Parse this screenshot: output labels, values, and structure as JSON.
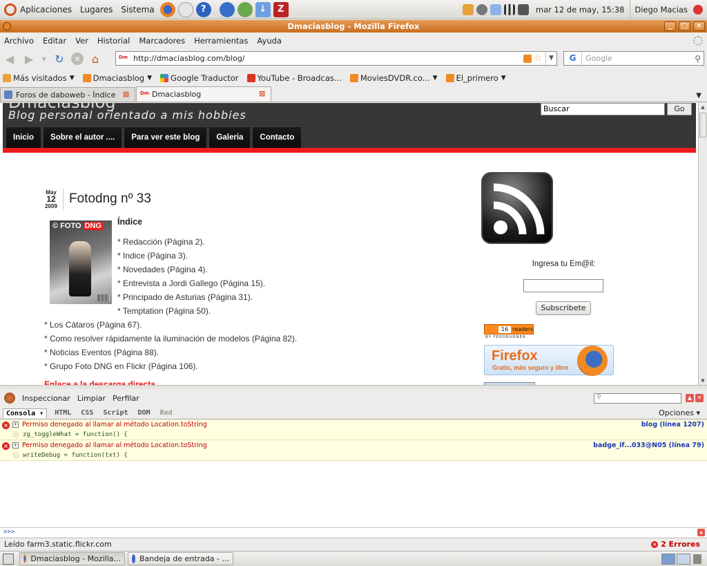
{
  "top_panel": {
    "menus": [
      "Aplicaciones",
      "Lugares",
      "Sistema"
    ],
    "clock": "mar 12 de may, 15:38",
    "user": "Diego Macias"
  },
  "window": {
    "title": "Dmaciasblog - Mozilla Firefox",
    "menu": [
      "Archivo",
      "Editar",
      "Ver",
      "Historial",
      "Marcadores",
      "Herramientas",
      "Ayuda"
    ]
  },
  "nav": {
    "url": "http://dmaciasblog.com/blog/",
    "url_favicon": "Dm",
    "search_placeholder": "Google",
    "search_engine_glyph": "G"
  },
  "bookmarks": [
    "Más visitados",
    "Dmaciasblog",
    "Google Traductor",
    "YouTube - Broadcas...",
    "MoviesDVDR.co...",
    "El_primero"
  ],
  "tabs": [
    {
      "label": "Foros de daboweb - Índice",
      "icon": ""
    },
    {
      "label": "Dmaciasblog",
      "icon": "Dm"
    }
  ],
  "blog": {
    "title": "Dmaciasblog",
    "tagline": "Blog personal orientado a mis hobbies",
    "search_value": "Buscar",
    "search_button": "Go",
    "nav": [
      "Inicio",
      "Sobre el autor ....",
      "Para ver este blog",
      "Galeria",
      "Contacto"
    ],
    "post": {
      "date_month": "May",
      "date_day": "12",
      "date_year": "2009",
      "title": "Fotodng nº 33",
      "magazine_logo_a": "FOTO",
      "magazine_logo_b": "DNG",
      "toc_title": "Índice",
      "toc_indented": [
        "* Redacción (Página 2).",
        "* Indice (Página 3).",
        "* Novedades (Página 4).",
        "* Entrevista a Jordi Gallego (Página 15).",
        "* Principado de Asturias (Página 31).",
        "* Temptation (Página 50)."
      ],
      "toc_outdented": [
        "* Los Cátaros (Página 67).",
        "* Como resolver rápidamente la iluminación de modelos (Página 82).",
        "* Noticias Eventos (Página 88).",
        "* Grupo Foto DNG en Flickr (Página 106)."
      ],
      "download_link": "Enlace a la descarga directa"
    },
    "sidebar": {
      "email_label": "Ingresa tu Em@il:",
      "subscribe_button": "Subscribete",
      "feed_count": "16",
      "feed_label": "readers",
      "feed_by": "BY FEEDBURNER",
      "firefox_title": "Firefox",
      "firefox_sub": "Gratis, más seguro y libre"
    }
  },
  "firebug": {
    "toolbar": [
      "Inspeccionar",
      "Limpiar",
      "Perfilar"
    ],
    "tabs": [
      "Consola",
      "HTML",
      "CSS",
      "Script",
      "DOM",
      "Red"
    ],
    "options": "Opciones",
    "errors": [
      {
        "message": "Permiso denegado al llamar al método Location.toString",
        "code": "zg_toggleWhat = function() {",
        "source": "blog (línea 1207)"
      },
      {
        "message": "Permiso denegado al llamar al método Location.toString",
        "code": "writeDebug = function(txt) {",
        "source": "badge_if...033@N05 (línea 79)"
      }
    ],
    "prompt": ">>>"
  },
  "status": {
    "text": "Leído farm3.static.flickr.com",
    "errors": "2 Errores"
  },
  "taskbar": [
    "Dmaciasblog - Mozilla...",
    "Bandeja de entrada - ..."
  ]
}
